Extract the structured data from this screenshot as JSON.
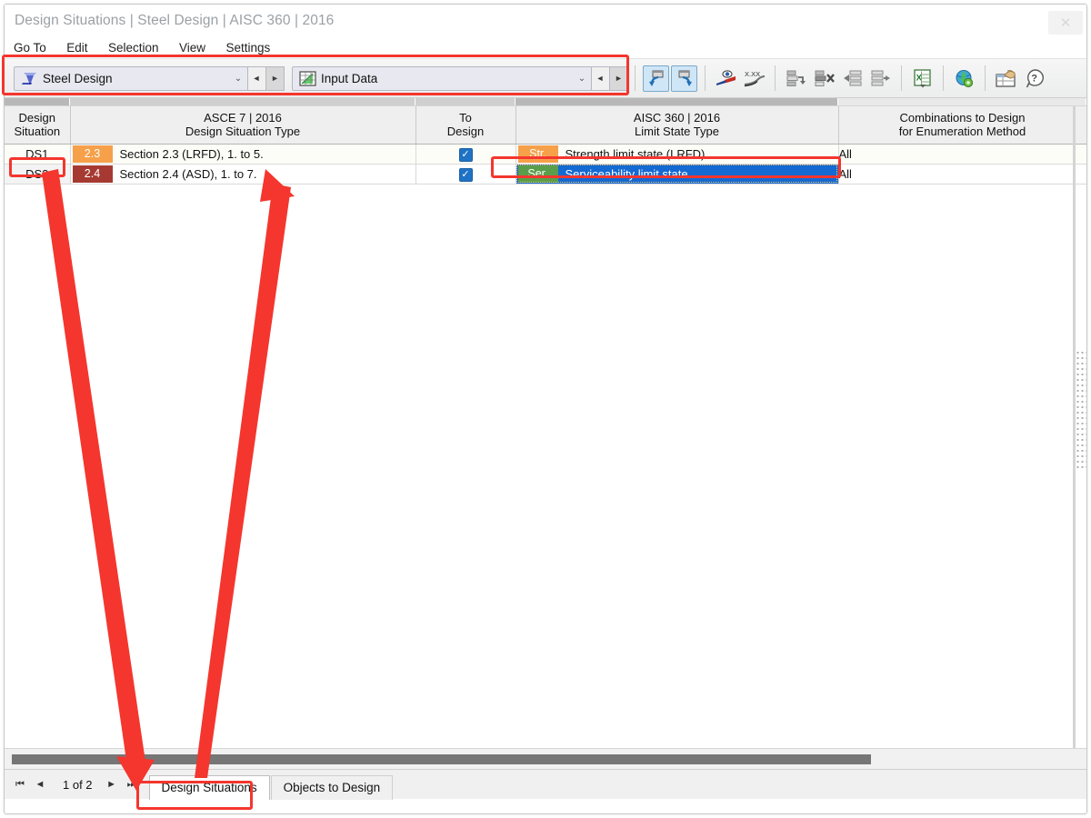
{
  "window": {
    "title": "Design Situations | Steel Design | AISC 360 | 2016",
    "close_label": "✕"
  },
  "menubar": {
    "items": [
      {
        "label": "Go To"
      },
      {
        "label": "Edit"
      },
      {
        "label": "Selection"
      },
      {
        "label": "View"
      },
      {
        "label": "Settings"
      }
    ]
  },
  "toolbar": {
    "module_combo": {
      "value": "Steel Design",
      "icon": "i-beam-icon",
      "caret": "⌄",
      "prev": "◄",
      "next": "►"
    },
    "table_combo": {
      "value": "Input Data",
      "icon": "input-data-table-icon",
      "caret": "⌄",
      "prev": "◄",
      "next": "►"
    },
    "buttons": [
      {
        "name": "undo-navigation-button",
        "state": "active"
      },
      {
        "name": "redo-navigation-button",
        "state": "active"
      },
      {
        "name": "view-visibility-button",
        "state": "normal"
      },
      {
        "name": "decimal-places-button",
        "state": "normal",
        "label": "X.XX"
      },
      {
        "name": "insert-row-button",
        "state": "normal"
      },
      {
        "name": "delete-row-button",
        "state": "normal"
      },
      {
        "name": "import-rows-button",
        "state": "normal"
      },
      {
        "name": "export-rows-button",
        "state": "normal"
      },
      {
        "name": "excel-export-button",
        "state": "normal",
        "label": "X"
      },
      {
        "name": "web-globe-button",
        "state": "normal"
      },
      {
        "name": "table-settings-button",
        "state": "normal"
      },
      {
        "name": "help-button",
        "state": "normal",
        "label": "?"
      }
    ]
  },
  "table": {
    "columns": [
      {
        "name": "design-situation",
        "line1": "Design",
        "line2": "Situation"
      },
      {
        "name": "design-situation-type",
        "line1": "ASCE 7 | 2016",
        "line2": "Design Situation Type"
      },
      {
        "name": "to-design",
        "line1": "To",
        "line2": "Design"
      },
      {
        "name": "limit-state-type",
        "line1": "AISC 360 | 2016",
        "line2": "Limit State Type"
      },
      {
        "name": "combinations-to-design",
        "line1": "Combinations to Design",
        "line2": "for Enumeration Method"
      }
    ],
    "rows": [
      {
        "id": "DS1",
        "situation_badge": "2.3",
        "situation_badge_color": "#f6a04a",
        "situation_text": "Section 2.3 (LRFD), 1. to 5.",
        "to_design": true,
        "limit_badge": "Str.",
        "limit_badge_color": "#f6a04a",
        "limit_text": "Strength limit state (LRFD)",
        "combinations": "All",
        "selected": false
      },
      {
        "id": "DS2",
        "situation_badge": "2.4",
        "situation_badge_color": "#a63a32",
        "situation_text": "Section 2.4 (ASD), 1. to 7.",
        "to_design": true,
        "limit_badge": "Ser.",
        "limit_badge_color": "#5a9e4b",
        "limit_text": "Serviceability limit state",
        "combinations": "All",
        "selected": true
      }
    ],
    "checkmark": "✓"
  },
  "statusbar": {
    "first": "⏮",
    "prev": "◄",
    "pager": "1 of 2",
    "next": "►",
    "last": "⏭",
    "tabs": [
      {
        "label": "Design Situations",
        "active": true
      },
      {
        "label": "Objects to Design",
        "active": false
      }
    ]
  },
  "colors": {
    "annotation": "#f4362e",
    "selection": "#1469d2",
    "checkbox": "#1f72c4",
    "toolbar_active": "#cfe6f7"
  }
}
